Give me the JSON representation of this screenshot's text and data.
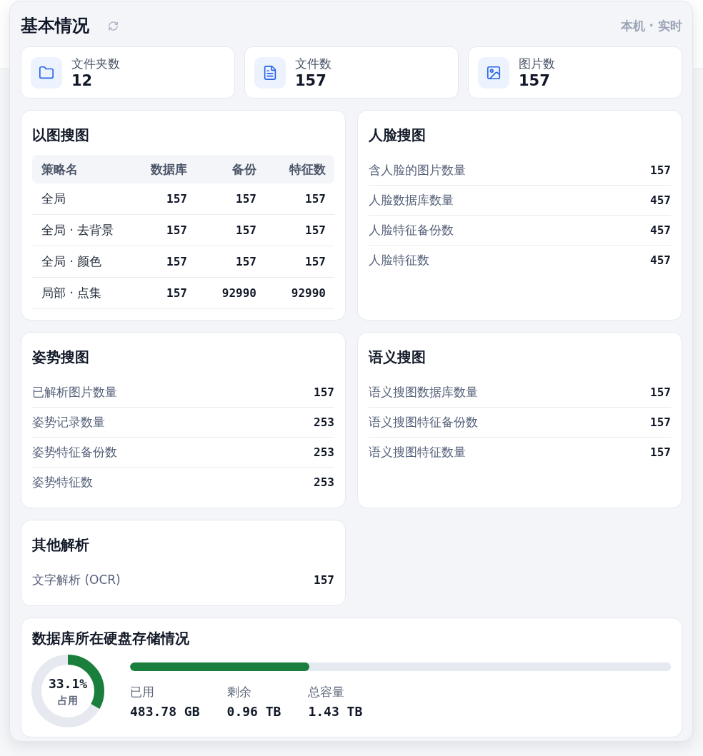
{
  "header": {
    "title": "基本情况",
    "scope": "本机 · 实时"
  },
  "stats": [
    {
      "kind": "folder",
      "label": "文件夹数",
      "value": "12"
    },
    {
      "kind": "file",
      "label": "文件数",
      "value": "157"
    },
    {
      "kind": "image",
      "label": "图片数",
      "value": "157"
    }
  ],
  "sections": [
    {
      "kind": "table",
      "title": "以图搜图",
      "columns": [
        "策略名",
        "数据库",
        "备份",
        "特征数"
      ],
      "rows": [
        [
          "全局",
          "157",
          "157",
          "157"
        ],
        [
          "全局 · 去背景",
          "157",
          "157",
          "157"
        ],
        [
          "全局 · 颜色",
          "157",
          "157",
          "157"
        ],
        [
          "局部 · 点集",
          "157",
          "92990",
          "92990"
        ]
      ]
    },
    {
      "kind": "list",
      "title": "人脸搜图",
      "rows": [
        {
          "label": "含人脸的图片数量",
          "value": "157"
        },
        {
          "label": "人脸数据库数量",
          "value": "457"
        },
        {
          "label": "人脸特征备份数",
          "value": "457"
        },
        {
          "label": "人脸特征数",
          "value": "457"
        }
      ]
    },
    {
      "kind": "list",
      "title": "姿势搜图",
      "rows": [
        {
          "label": "已解析图片数量",
          "value": "157"
        },
        {
          "label": "姿势记录数量",
          "value": "253"
        },
        {
          "label": "姿势特征备份数",
          "value": "253"
        },
        {
          "label": "姿势特征数",
          "value": "253"
        }
      ]
    },
    {
      "kind": "list",
      "title": "语义搜图",
      "rows": [
        {
          "label": "语义搜图数据库数量",
          "value": "157"
        },
        {
          "label": "语义搜图特征备份数",
          "value": "157"
        },
        {
          "label": "语义搜图特征数量",
          "value": "157"
        }
      ]
    },
    {
      "kind": "list",
      "title": "其他解析",
      "rows": [
        {
          "label": "文字解析 (OCR)",
          "value": "157"
        }
      ]
    }
  ],
  "storage": {
    "title": "数据库所在硬盘存储情况",
    "level": 0.331,
    "percent": "33.1%",
    "caption": "占用",
    "stats": [
      {
        "label": "已用",
        "value": "483.78 GB"
      },
      {
        "label": "剩余",
        "value": "0.96 TB"
      },
      {
        "label": "总容量",
        "value": "1.43 TB"
      }
    ]
  }
}
